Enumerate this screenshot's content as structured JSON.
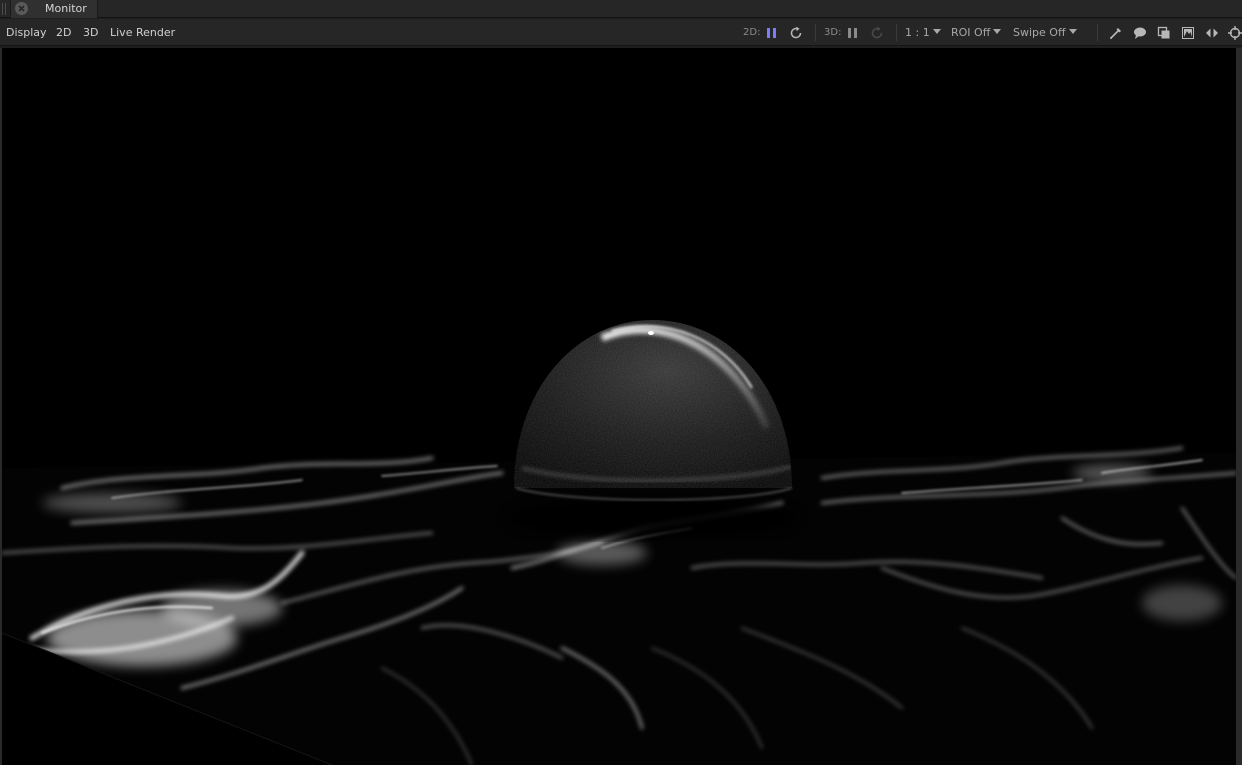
{
  "window": {
    "tab_label": "Monitor"
  },
  "toolbar": {
    "menu": {
      "display": "Display",
      "2d": "2D",
      "3d": "3D",
      "live_render": "Live Render"
    },
    "label_2d": "2D:",
    "label_3d": "3D:",
    "zoom_value": "1 : 1",
    "roi_value": "ROI Off",
    "swipe_value": "Swipe Off",
    "icons": {
      "pause_2d": "pause-icon",
      "refresh_2d": "refresh-icon",
      "pause_3d": "pause-icon",
      "refresh_3d": "refresh-icon",
      "picker": "eyedropper-icon",
      "comment": "speech-bubble-icon",
      "overlay": "overlay-icon",
      "snapshot": "snapshot-icon",
      "compare": "compare-arrows-icon",
      "target": "crosshair-icon"
    }
  },
  "colors": {
    "accent_pause": "#7b7bff",
    "panel": "#262626",
    "viewport": "#000000"
  }
}
